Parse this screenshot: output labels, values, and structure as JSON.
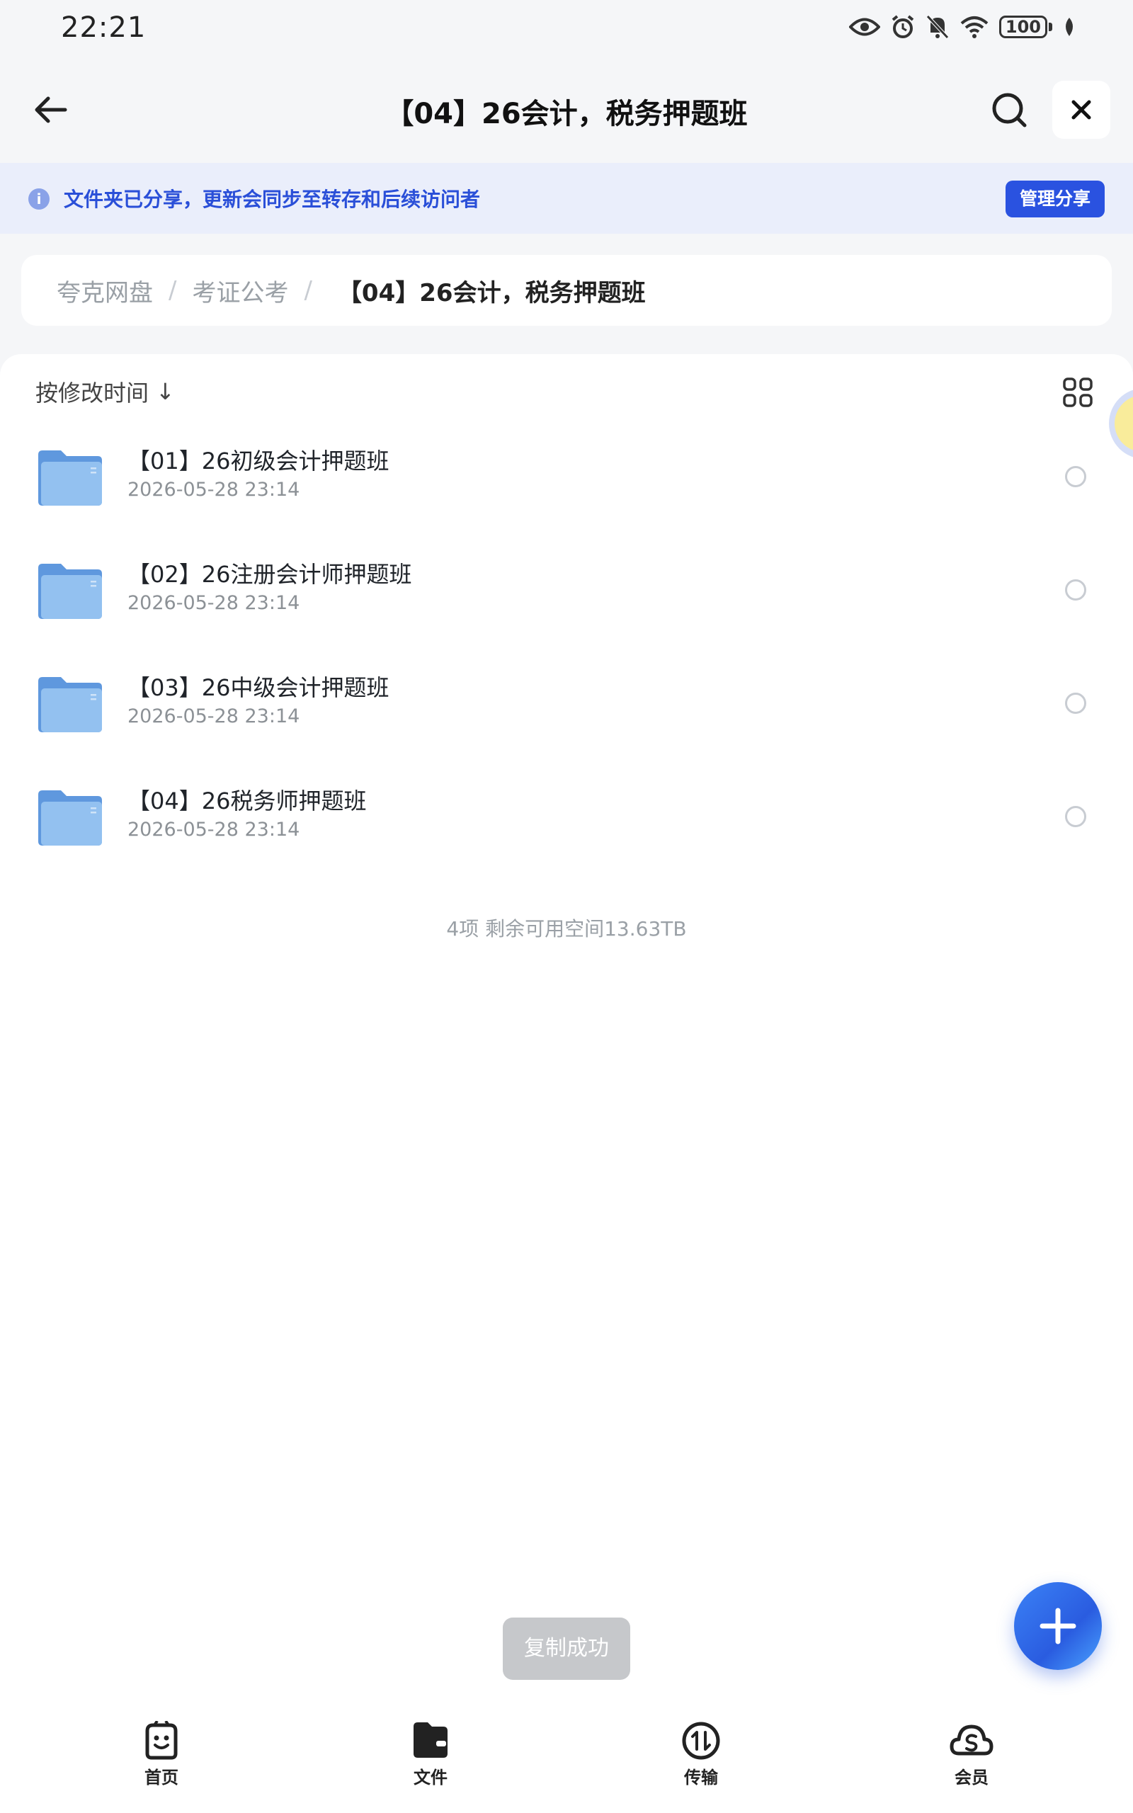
{
  "status": {
    "time": "22:21",
    "battery": "100"
  },
  "nav": {
    "title": "【04】26会计，税务押题班"
  },
  "banner": {
    "text": "文件夹已分享，更新会同步至转存和后续访问者",
    "button": "管理分享",
    "info_glyph": "i"
  },
  "breadcrumb": {
    "items": [
      "夸克网盘",
      "考证公考"
    ],
    "separator": "/",
    "current": "【04】26会计，税务押题班"
  },
  "sort": {
    "label": "按修改时间",
    "arrow": "↓"
  },
  "files": [
    {
      "name": "【01】26初级会计押题班",
      "date": "2026-05-28 23:14"
    },
    {
      "name": "【02】26注册会计师押题班",
      "date": "2026-05-28 23:14"
    },
    {
      "name": "【03】26中级会计押题班",
      "date": "2026-05-28 23:14"
    },
    {
      "name": "【04】26税务师押题班",
      "date": "2026-05-28 23:14"
    }
  ],
  "summary": "4项 剩余可用空间13.63TB",
  "toast": "复制成功",
  "tabs": [
    {
      "label": "首页",
      "icon": "home-smile-icon"
    },
    {
      "label": "文件",
      "icon": "folder-icon"
    },
    {
      "label": "传输",
      "icon": "transfer-icon"
    },
    {
      "label": "会员",
      "icon": "member-cloud-icon"
    }
  ],
  "colors": {
    "accent": "#2a52e0",
    "banner_bg": "#eaeefb",
    "folder": "#7fb2ea"
  }
}
